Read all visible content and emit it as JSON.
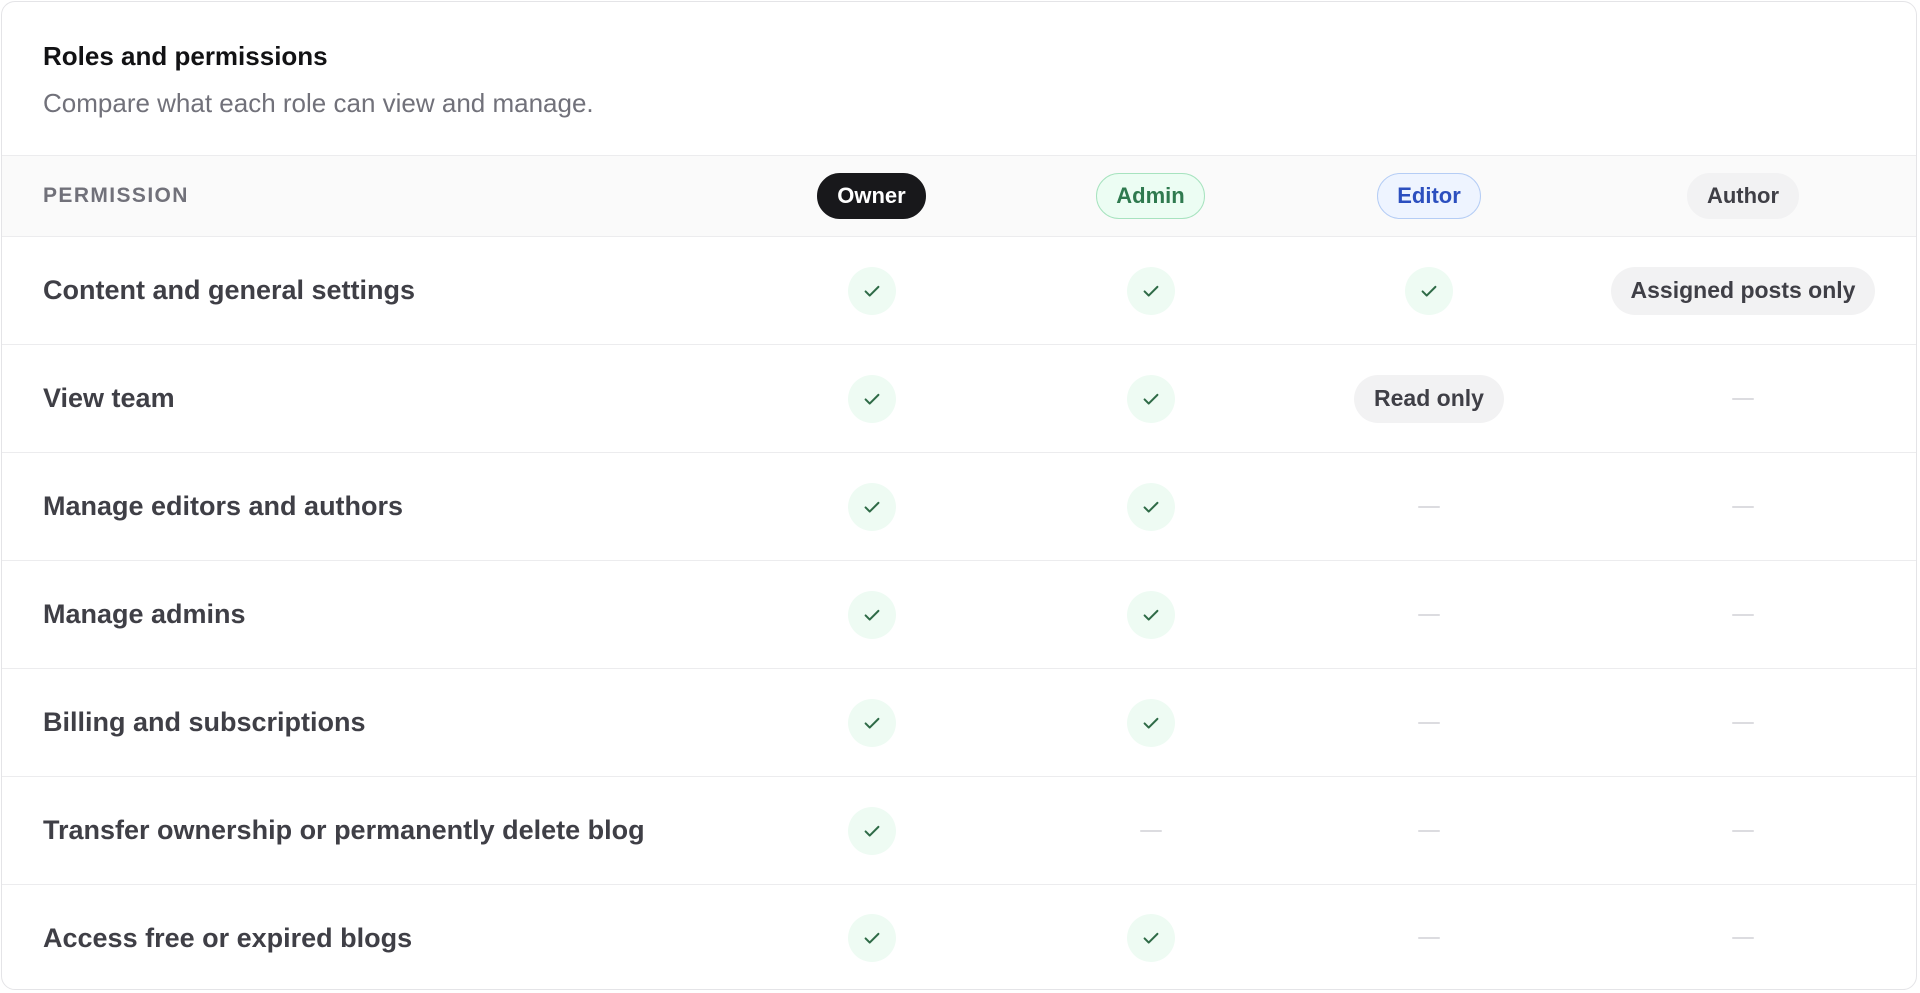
{
  "header": {
    "title": "Roles and permissions",
    "subtitle": "Compare what each role can view and manage."
  },
  "columns": {
    "permission": "PERMISSION",
    "owner": "Owner",
    "admin": "Admin",
    "editor": "Editor",
    "author": "Author"
  },
  "rows": [
    {
      "label": "Content and general settings",
      "owner": "check",
      "admin": "check",
      "editor": "check",
      "author": "Assigned posts only"
    },
    {
      "label": "View team",
      "owner": "check",
      "admin": "check",
      "editor": "Read only",
      "author": "none"
    },
    {
      "label": "Manage editors and authors",
      "owner": "check",
      "admin": "check",
      "editor": "none",
      "author": "none"
    },
    {
      "label": "Manage admins",
      "owner": "check",
      "admin": "check",
      "editor": "none",
      "author": "none"
    },
    {
      "label": "Billing and subscriptions",
      "owner": "check",
      "admin": "check",
      "editor": "none",
      "author": "none"
    },
    {
      "label": "Transfer ownership or permanently delete blog",
      "owner": "check",
      "admin": "none",
      "editor": "none",
      "author": "none"
    },
    {
      "label": "Access free or expired blogs",
      "owner": "check",
      "admin": "check",
      "editor": "none",
      "author": "none"
    }
  ],
  "colors": {
    "check_background": "#eefbf3",
    "check_stroke": "#2f6b47",
    "owner_pill": "#18181b",
    "admin_pill_text": "#2f7a4f",
    "editor_pill_text": "#2c4fbf"
  },
  "icons": {
    "granted": "check-icon",
    "denied": "dash-icon"
  }
}
